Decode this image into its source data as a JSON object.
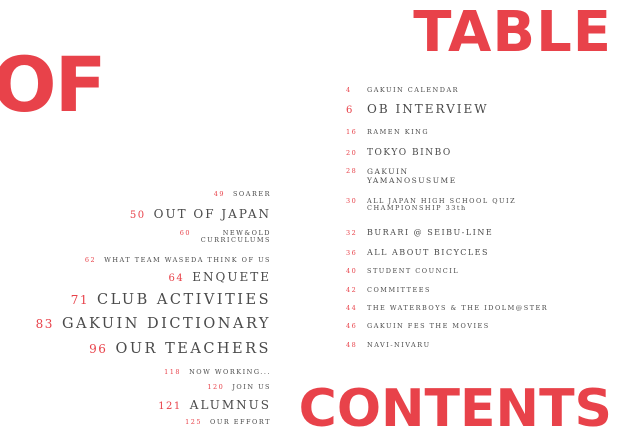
{
  "heading": {
    "table": "TABLE",
    "of": "OF",
    "contents": "CONTENTS"
  },
  "colors": {
    "accent": "#e8424a",
    "text": "#4a4a4a"
  },
  "left_entries": [
    {
      "num": "49",
      "title": "SOARER"
    },
    {
      "num": "50",
      "title": "OUT OF JAPAN"
    },
    {
      "num": "60",
      "title": "NEW&OLD CURRICULUMS"
    },
    {
      "num": "62",
      "title": "WHAT TEAM WASEDA THINK OF US"
    },
    {
      "num": "64",
      "title": "ENQUETE"
    },
    {
      "num": "71",
      "title": "CLUB ACTIVITIES"
    },
    {
      "num": "83",
      "title": "GAKUIN DICTIONARY"
    },
    {
      "num": "96",
      "title": "OUR TEACHERS"
    },
    {
      "num": "118",
      "title": "NOW WORKING..."
    },
    {
      "num": "120",
      "title": "JOIN US"
    },
    {
      "num": "121",
      "title": "ALUMNUS"
    },
    {
      "num": "125",
      "title": "OUR EFFORT"
    }
  ],
  "right_entries": [
    {
      "num": "4",
      "title": "GAKUIN CALENDAR"
    },
    {
      "num": "6",
      "title": "OB INTERVIEW"
    },
    {
      "num": "16",
      "title": "RAMEN KING"
    },
    {
      "num": "20",
      "title": "TOKYO BINBO"
    },
    {
      "num": "28",
      "title": "GAKUIN YAMANOSUSUME"
    },
    {
      "num": "30",
      "title": "ALL JAPAN HIGH SCHOOL QUIZ CHAMPIONSHIP 33th"
    },
    {
      "num": "32",
      "title": "BURARI @ SEIBU-LINE"
    },
    {
      "num": "36",
      "title": "ALL ABOUT BICYCLES"
    },
    {
      "num": "40",
      "title": "STUDENT COUNCIL"
    },
    {
      "num": "42",
      "title": "COMMITTEES"
    },
    {
      "num": "44",
      "title": "THE WATERBOYS & THE IDOLM@STER"
    },
    {
      "num": "46",
      "title": "GAKUIN FES THE MOVIES"
    },
    {
      "num": "48",
      "title": "NAVI-NIVARU"
    }
  ]
}
